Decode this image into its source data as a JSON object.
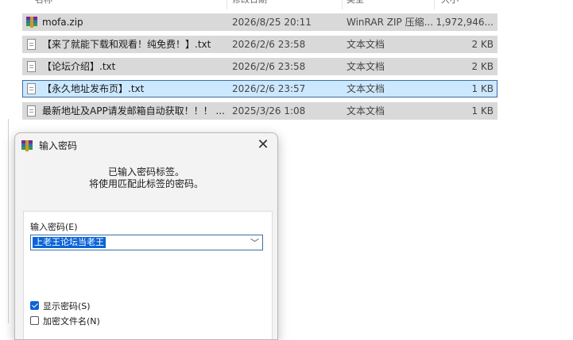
{
  "explorer": {
    "columns": [
      "名称",
      "修改日期",
      "类型",
      "大小"
    ],
    "files": [
      {
        "name": "mofa.zip",
        "date": "2026/8/25 20:11",
        "type": "WinRAR ZIP 压缩...",
        "size": "1,972,946...",
        "icon": "rar-archive-icon",
        "selected": false
      },
      {
        "name": "【来了就能下载和观看！纯免费！】.txt",
        "date": "2026/2/6 23:58",
        "type": "文本文档",
        "size": "2 KB",
        "icon": "text-file-icon",
        "selected": false
      },
      {
        "name": "【论坛介绍】.txt",
        "date": "2026/2/6 23:58",
        "type": "文本文档",
        "size": "2 KB",
        "icon": "text-file-icon",
        "selected": false
      },
      {
        "name": "【永久地址发布页】.txt",
        "date": "2026/2/6 23:57",
        "type": "文本文档",
        "size": "1 KB",
        "icon": "text-file-icon",
        "selected": true
      },
      {
        "name": "最新地址及APP请发邮箱自动获取！！！ ...",
        "date": "2025/3/26 1:08",
        "type": "文本文档",
        "size": "1 KB",
        "icon": "text-file-icon",
        "selected": false
      }
    ]
  },
  "dialog": {
    "title": "输入密码",
    "close_glyph": "✕",
    "message_line1": "已输入密码标签。",
    "message_line2": "将使用匹配此标签的密码。",
    "password_label": "输入密码(E)",
    "password_value": "上老王论坛当老王",
    "dropdown_glyph": "﹀",
    "show_password_label": "显示密码(S)",
    "show_password_checked": true,
    "encrypt_filenames_label": "加密文件名(N)",
    "encrypt_filenames_checked": false
  },
  "colors": {
    "row_bg": "#d9d9d9",
    "selected_row_bg": "#cce8ff",
    "selected_border": "#3a6ea5",
    "selection_highlight": "#0a64d8"
  }
}
